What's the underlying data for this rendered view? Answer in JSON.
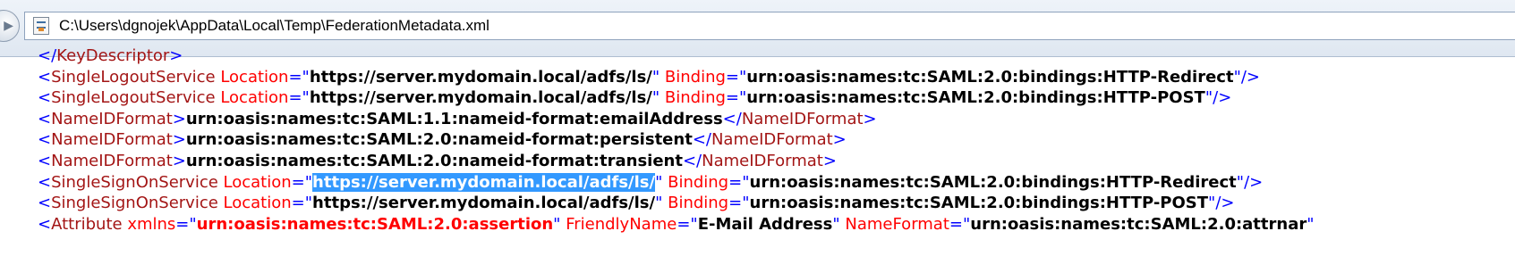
{
  "window": {
    "address": "C:\\Users\\dgnojek\\AppData\\Local\\Temp\\FederationMetadata.xml"
  },
  "xml_lines": [
    {
      "kind": "end",
      "tag": "KeyDescriptor"
    },
    {
      "kind": "empty",
      "tag": "SingleLogoutService",
      "attrs": [
        {
          "name": "Location",
          "value": "https://server.mydomain.local/adfs/ls/"
        },
        {
          "name": "Binding",
          "value": "urn:oasis:names:tc:SAML:2.0:bindings:HTTP-Redirect"
        }
      ]
    },
    {
      "kind": "empty",
      "tag": "SingleLogoutService",
      "attrs": [
        {
          "name": "Location",
          "value": "https://server.mydomain.local/adfs/ls/"
        },
        {
          "name": "Binding",
          "value": "urn:oasis:names:tc:SAML:2.0:bindings:HTTP-POST"
        }
      ]
    },
    {
      "kind": "element",
      "tag": "NameIDFormat",
      "text": "urn:oasis:names:tc:SAML:1.1:nameid-format:emailAddress"
    },
    {
      "kind": "element",
      "tag": "NameIDFormat",
      "text": "urn:oasis:names:tc:SAML:2.0:nameid-format:persistent"
    },
    {
      "kind": "element",
      "tag": "NameIDFormat",
      "text": "urn:oasis:names:tc:SAML:2.0:nameid-format:transient"
    },
    {
      "kind": "empty",
      "tag": "SingleSignOnService",
      "attrs": [
        {
          "name": "Location",
          "value": "https://server.mydomain.local/adfs/ls/",
          "selected": true
        },
        {
          "name": "Binding",
          "value": "urn:oasis:names:tc:SAML:2.0:bindings:HTTP-Redirect"
        }
      ]
    },
    {
      "kind": "empty",
      "tag": "SingleSignOnService",
      "attrs": [
        {
          "name": "Location",
          "value": "https://server.mydomain.local/adfs/ls/"
        },
        {
          "name": "Binding",
          "value": "urn:oasis:names:tc:SAML:2.0:bindings:HTTP-POST"
        }
      ]
    },
    {
      "kind": "open",
      "tag": "Attribute",
      "attrs": [
        {
          "name": "xmlns",
          "value": "urn:oasis:names:tc:SAML:2.0:assertion",
          "namespace": true
        },
        {
          "name": "FriendlyName",
          "value": "E-Mail Address"
        },
        {
          "name": "NameFormat",
          "value": "urn:oasis:names:tc:SAML:2.0:attrnar"
        }
      ]
    }
  ],
  "colors": {
    "tag": "#a31515",
    "punctuation": "#0000ff",
    "attribute": "#ff0000",
    "selection": "#3399ff"
  }
}
